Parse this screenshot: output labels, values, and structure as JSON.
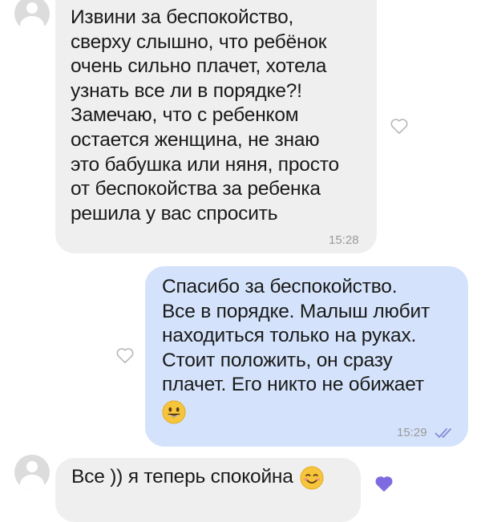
{
  "messages": [
    {
      "direction": "incoming",
      "text": "Извини за беспокойство,\nсверху слышно, что ребёнок\nочень сильно плачет, хотела\nузнать все ли в порядке?!\nЗамечаю, что с ребенком\nостается женщина, не знаю\nэто бабушка или няня, просто\nот беспокойства за ребенка\nрешила у вас спросить",
      "time": "15:28"
    },
    {
      "direction": "outgoing",
      "text": "Спасибо за беспокойство.\nВсе в порядке. Малыш любит\nнаходиться только на руках.\nСтоит положить, он сразу\nплачет. Его никто не обижает",
      "emoji": "smiling-face-emoji",
      "time": "15:29",
      "status_icon": "double-check-icon"
    },
    {
      "direction": "incoming",
      "text": "Все )) я теперь спокойна",
      "emoji": "smiling-face-blush-emoji"
    }
  ],
  "colors": {
    "incoming_bubble": "#efefef",
    "outgoing_bubble": "#d4e3fb",
    "timestamp": "#9a9a9a",
    "read_check": "#8a8ad6",
    "reaction_heart": "#7f6be0"
  }
}
